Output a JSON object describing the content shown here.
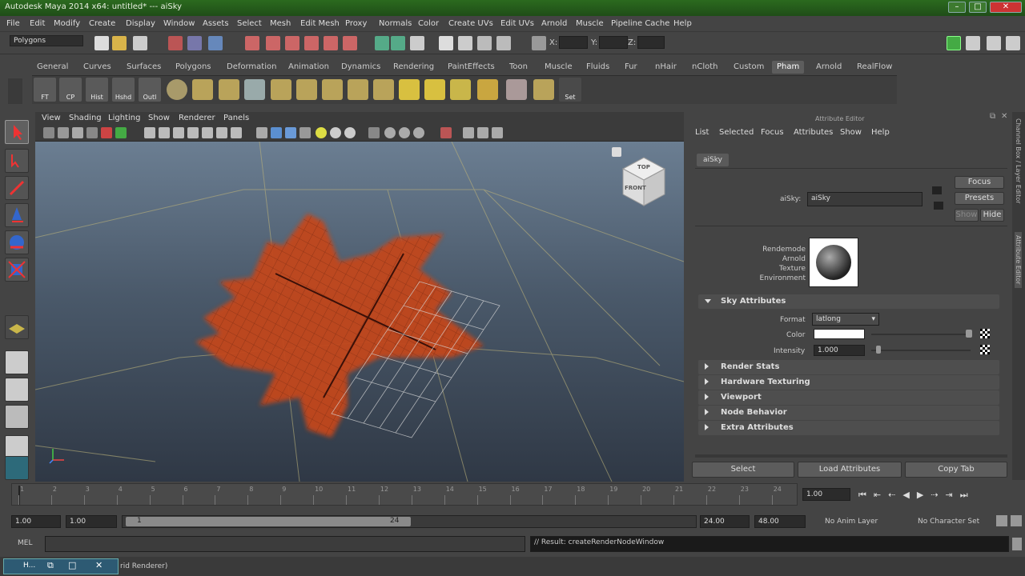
{
  "titlebar": {
    "title": "Autodesk Maya 2014 x64: untitled*    ---    aiSky"
  },
  "menubar": {
    "items": [
      "File",
      "Edit",
      "Modify",
      "Create",
      "Display",
      "Window",
      "Assets",
      "Select",
      "Mesh",
      "Edit Mesh",
      "Proxy",
      "Normals",
      "Color",
      "Create UVs",
      "Edit UVs",
      "Arnold",
      "Muscle",
      "Pipeline Cache",
      "Help"
    ]
  },
  "statusline": {
    "mode": "Polygons",
    "x_label": "X:",
    "y_label": "Y:",
    "z_label": "Z:"
  },
  "shelf": {
    "tabs": [
      "General",
      "Curves",
      "Surfaces",
      "Polygons",
      "Deformation",
      "Animation",
      "Dynamics",
      "Rendering",
      "PaintEffects",
      "Toon",
      "Muscle",
      "Fluids",
      "Fur",
      "nHair",
      "nCloth",
      "Custom",
      "Pham",
      "Arnold",
      "RealFlow"
    ],
    "active_tab": "Pham",
    "buttons": [
      "FT",
      "CP",
      "Hist",
      "Hshd",
      "Outl"
    ],
    "set_label": "Set"
  },
  "viewport": {
    "menu": [
      "View",
      "Shading",
      "Lighting",
      "Show",
      "Renderer",
      "Panels"
    ],
    "viewcube_top": "TOP",
    "viewcube_front": "FRONT"
  },
  "attribute_editor": {
    "title": "Attribute Editor",
    "menu": [
      "List",
      "Selected",
      "Focus",
      "Attributes",
      "Show",
      "Help"
    ],
    "node_tab": "aiSky",
    "node_label": "aiSky:",
    "node_value": "aiSky",
    "focus": "Focus",
    "presets": "Presets",
    "show": "Show",
    "hide": "Hide",
    "swatch_lines": [
      "Rendemode",
      "Arnold",
      "Texture",
      "Environment"
    ],
    "sky_section": "Sky Attributes",
    "format_label": "Format",
    "format_value": "latlong",
    "color_label": "Color",
    "intensity_label": "Intensity",
    "intensity_value": "1.000",
    "sections": [
      "Render Stats",
      "Hardware Texturing",
      "Viewport",
      "Node Behavior",
      "Extra Attributes"
    ],
    "buttons": [
      "Select",
      "Load Attributes",
      "Copy Tab"
    ]
  },
  "dock_tabs": [
    "Channel Box / Layer Editor",
    "Attribute Editor"
  ],
  "timeline": {
    "ticks": [
      "1",
      "2",
      "3",
      "4",
      "5",
      "6",
      "7",
      "8",
      "9",
      "10",
      "11",
      "12",
      "13",
      "14",
      "15",
      "16",
      "17",
      "18",
      "19",
      "20",
      "21",
      "22",
      "23",
      "24"
    ],
    "current_frame": "1.00"
  },
  "range": {
    "start": "1.00",
    "playback_start": "1.00",
    "slider_start": "1",
    "slider_end": "24",
    "playback_end": "24.00",
    "end": "48.00",
    "anim_layer": "No Anim Layer",
    "character_set": "No Character Set"
  },
  "cmdline": {
    "label": "MEL",
    "result": "// Result: createRenderNodeWindow"
  },
  "helpline": {
    "text": "rid Renderer)",
    "task": "H..."
  },
  "colors": {
    "accent": "#5d8fc6",
    "bg": "#444444",
    "leaf": "#c2461e"
  }
}
